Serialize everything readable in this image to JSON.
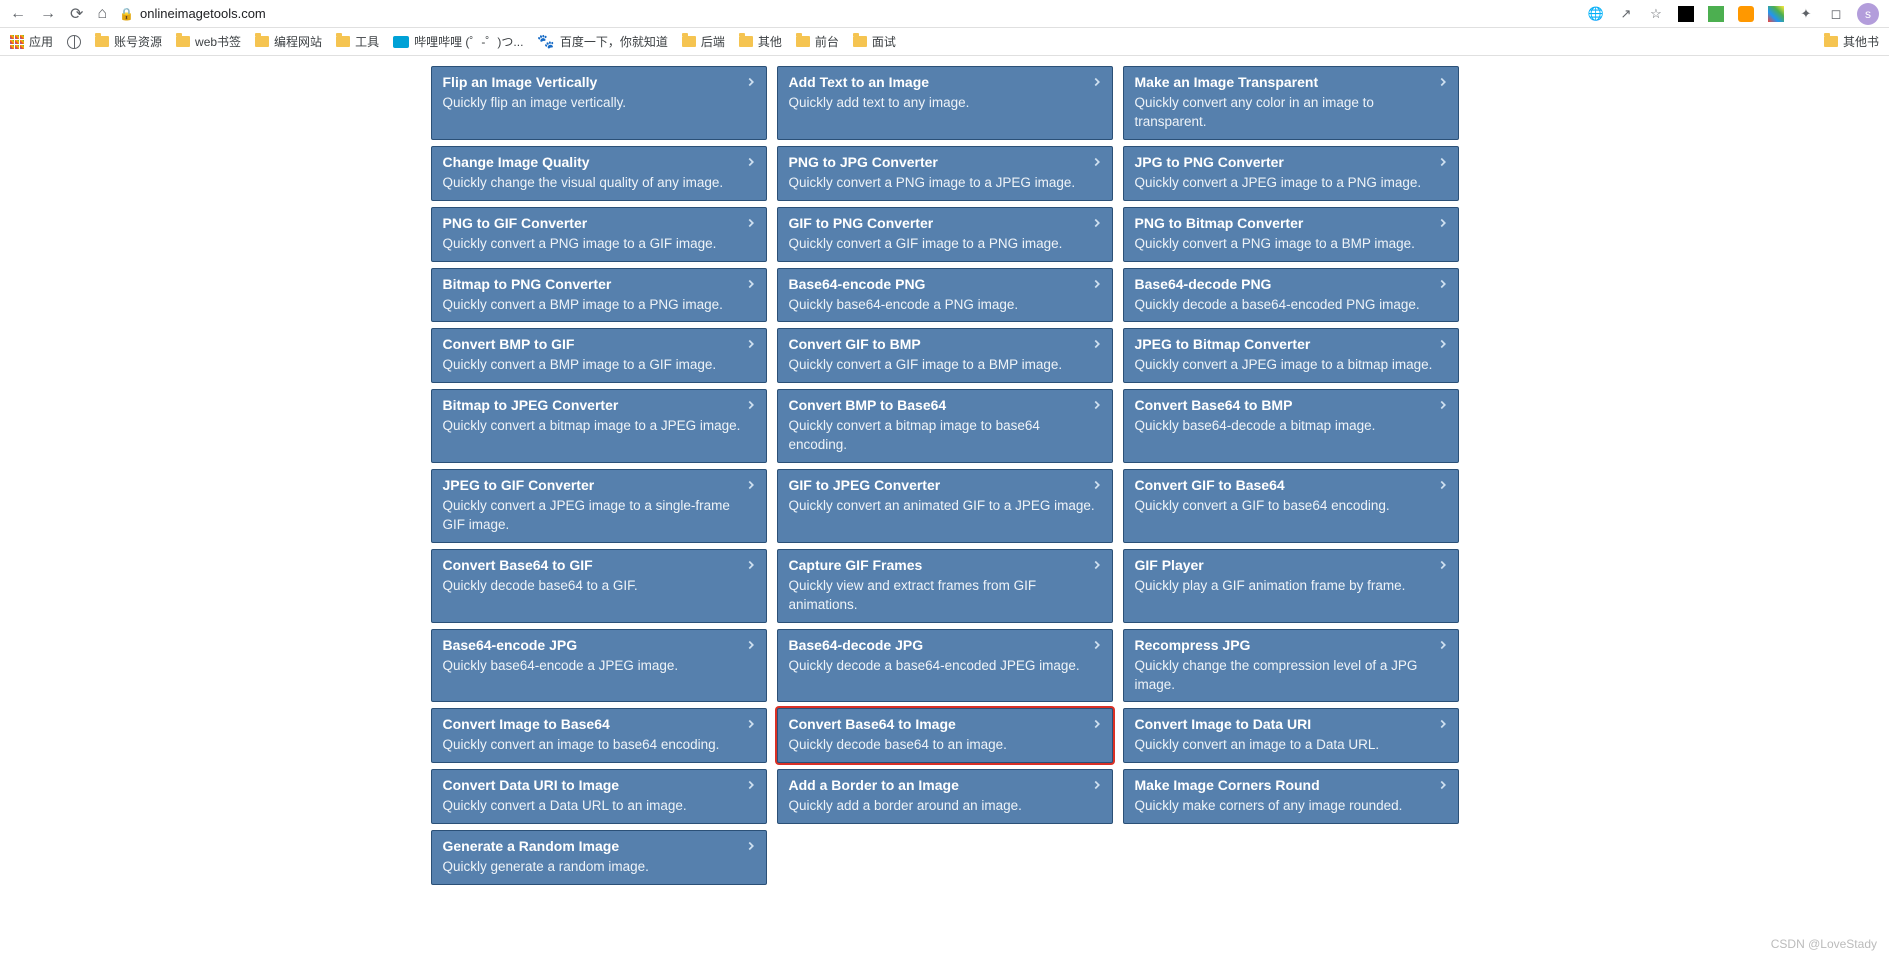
{
  "browser": {
    "url": "onlineimagetools.com",
    "avatar_letter": "s"
  },
  "bookmarks": {
    "items": [
      {
        "label": "应用",
        "icon": "apps"
      },
      {
        "label": "",
        "icon": "globe"
      },
      {
        "label": "账号资源",
        "icon": "folder"
      },
      {
        "label": "web书签",
        "icon": "folder"
      },
      {
        "label": "编程网站",
        "icon": "folder"
      },
      {
        "label": "工具",
        "icon": "folder"
      },
      {
        "label": "哔哩哔哩 (゜-゜)つ...",
        "icon": "bili"
      },
      {
        "label": "百度一下，你就知道",
        "icon": "paw"
      },
      {
        "label": "后端",
        "icon": "folder"
      },
      {
        "label": "其他",
        "icon": "folder"
      },
      {
        "label": "前台",
        "icon": "folder"
      },
      {
        "label": "面试",
        "icon": "folder"
      }
    ],
    "overflow": "其他书"
  },
  "cards": {
    "col1": [
      {
        "title": "Flip an Image Vertically",
        "desc": "Quickly flip an image vertically."
      },
      {
        "title": "Change Image Quality",
        "desc": "Quickly change the visual quality of any image."
      },
      {
        "title": "PNG to GIF Converter",
        "desc": "Quickly convert a PNG image to a GIF image."
      },
      {
        "title": "Bitmap to PNG Converter",
        "desc": "Quickly convert a BMP image to a PNG image."
      },
      {
        "title": "Convert BMP to GIF",
        "desc": "Quickly convert a BMP image to a GIF image."
      },
      {
        "title": "Bitmap to JPEG Converter",
        "desc": "Quickly convert a bitmap image to a JPEG image."
      },
      {
        "title": "JPEG to GIF Converter",
        "desc": "Quickly convert a JPEG image to a single-frame GIF image."
      },
      {
        "title": "Convert Base64 to GIF",
        "desc": "Quickly decode base64 to a GIF."
      },
      {
        "title": "Base64-encode JPG",
        "desc": "Quickly base64-encode a JPEG image."
      },
      {
        "title": "Convert Image to Base64",
        "desc": "Quickly convert an image to base64 encoding."
      },
      {
        "title": "Convert Data URI to Image",
        "desc": "Quickly convert a Data URL to an image."
      },
      {
        "title": "Generate a Random Image",
        "desc": "Quickly generate a random image."
      }
    ],
    "col2": [
      {
        "title": "Add Text to an Image",
        "desc": "Quickly add text to any image."
      },
      {
        "title": "PNG to JPG Converter",
        "desc": "Quickly convert a PNG image to a JPEG image."
      },
      {
        "title": "GIF to PNG Converter",
        "desc": "Quickly convert a GIF image to a PNG image."
      },
      {
        "title": "Base64-encode PNG",
        "desc": "Quickly base64-encode a PNG image."
      },
      {
        "title": "Convert GIF to BMP",
        "desc": "Quickly convert a GIF image to a BMP image."
      },
      {
        "title": "Convert BMP to Base64",
        "desc": "Quickly convert a bitmap image to base64 encoding."
      },
      {
        "title": "GIF to JPEG Converter",
        "desc": "Quickly convert an animated GIF to a JPEG image."
      },
      {
        "title": "Capture GIF Frames",
        "desc": "Quickly view and extract frames from GIF animations."
      },
      {
        "title": "Base64-decode JPG",
        "desc": "Quickly decode a base64-encoded JPEG image."
      },
      {
        "title": "Convert Base64 to Image",
        "desc": "Quickly decode base64 to an image.",
        "highlight": true
      },
      {
        "title": "Add a Border to an Image",
        "desc": "Quickly add a border around an image."
      }
    ],
    "col3": [
      {
        "title": "Make an Image Transparent",
        "desc": "Quickly convert any color in an image to transparent."
      },
      {
        "title": "JPG to PNG Converter",
        "desc": "Quickly convert a JPEG image to a PNG image."
      },
      {
        "title": "PNG to Bitmap Converter",
        "desc": "Quickly convert a PNG image to a BMP image."
      },
      {
        "title": "Base64-decode PNG",
        "desc": "Quickly decode a base64-encoded PNG image."
      },
      {
        "title": "JPEG to Bitmap Converter",
        "desc": "Quickly convert a JPEG image to a bitmap image."
      },
      {
        "title": "Convert Base64 to BMP",
        "desc": "Quickly base64-decode a bitmap image."
      },
      {
        "title": "Convert GIF to Base64",
        "desc": "Quickly convert a GIF to base64 encoding."
      },
      {
        "title": "GIF Player",
        "desc": "Quickly play a GIF animation frame by frame."
      },
      {
        "title": "Recompress JPG",
        "desc": "Quickly change the compression level of a JPG image."
      },
      {
        "title": "Convert Image to Data URI",
        "desc": "Quickly convert an image to a Data URL."
      },
      {
        "title": "Make Image Corners Round",
        "desc": "Quickly make corners of any image rounded."
      }
    ]
  },
  "watermark": "CSDN @LoveStady"
}
